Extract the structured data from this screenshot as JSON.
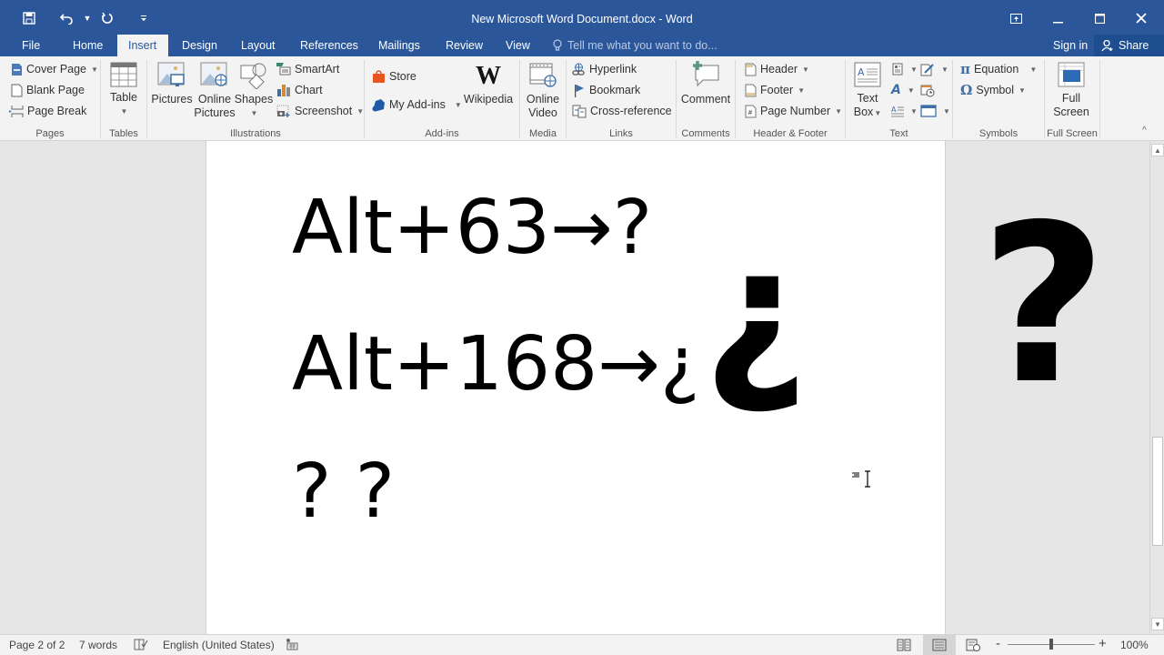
{
  "window": {
    "title": "New Microsoft Word Document.docx - Word",
    "controls": {
      "ribbon_display": "ribbon-display-options-icon",
      "minimize": "minimize-icon",
      "maximize": "maximize-icon",
      "close": "close-icon"
    }
  },
  "quick_access": {
    "save": "save-icon",
    "undo": "undo-icon",
    "redo": "redo-icon",
    "customize": "customize-qat-icon"
  },
  "tabs": [
    {
      "label": "File",
      "active": false
    },
    {
      "label": "Home",
      "active": false
    },
    {
      "label": "Insert",
      "active": true
    },
    {
      "label": "Design",
      "active": false
    },
    {
      "label": "Layout",
      "active": false
    },
    {
      "label": "References",
      "active": false
    },
    {
      "label": "Mailings",
      "active": false
    },
    {
      "label": "Review",
      "active": false
    },
    {
      "label": "View",
      "active": false
    }
  ],
  "tell_me": {
    "placeholder": "Tell me what you want to do..."
  },
  "account": {
    "sign_in": "Sign in",
    "share": "Share"
  },
  "ribbon": {
    "pages": {
      "label": "Pages",
      "cover_page": "Cover Page",
      "blank_page": "Blank Page",
      "page_break": "Page Break"
    },
    "tables": {
      "label": "Tables",
      "table": "Table"
    },
    "illustrations": {
      "label": "Illustrations",
      "pictures": "Pictures",
      "online_pictures_1": "Online",
      "online_pictures_2": "Pictures",
      "shapes": "Shapes",
      "smartart": "SmartArt",
      "chart": "Chart",
      "screenshot": "Screenshot"
    },
    "addins": {
      "label": "Add-ins",
      "store": "Store",
      "my_addins": "My Add-ins",
      "wikipedia": "Wikipedia"
    },
    "media": {
      "label": "Media",
      "online_video_1": "Online",
      "online_video_2": "Video"
    },
    "links": {
      "label": "Links",
      "hyperlink": "Hyperlink",
      "bookmark": "Bookmark",
      "cross_reference": "Cross-reference"
    },
    "comments": {
      "label": "Comments",
      "comment": "Comment"
    },
    "header_footer": {
      "label": "Header & Footer",
      "header": "Header",
      "footer": "Footer",
      "page_number": "Page Number"
    },
    "text": {
      "label": "Text",
      "text_box_1": "Text",
      "text_box_2": "Box"
    },
    "symbols": {
      "label": "Symbols",
      "equation": "Equation",
      "symbol": "Symbol"
    },
    "full_screen": {
      "label": "Full Screen",
      "btn_1": "Full",
      "btn_2": "Screen"
    }
  },
  "document": {
    "line1": "Alt+63→?",
    "line2": "Alt+168→¿",
    "big_inverted": "¿",
    "line3": "? ?",
    "margin_big_question": "?"
  },
  "statusbar": {
    "page": "Page 2 of 2",
    "words": "7 words",
    "language": "English (United States)",
    "zoom_minus": "-",
    "zoom_plus": "+",
    "zoom_level": "100%",
    "zoom_percent": 100
  },
  "colors": {
    "accent": "#2b579a",
    "ribbon_bg": "#f3f3f3",
    "canvas_bg": "#e6e6e6"
  }
}
